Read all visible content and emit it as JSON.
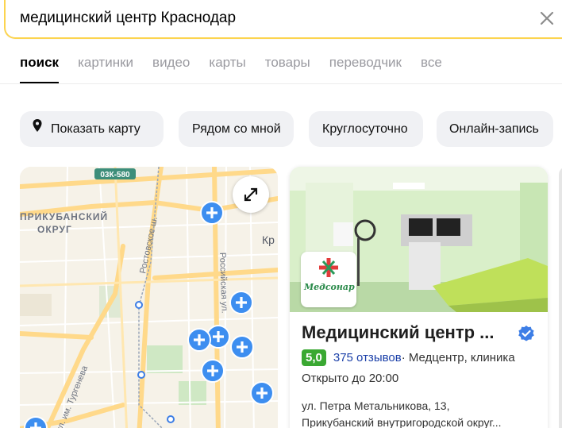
{
  "search": {
    "query": "медицинский центр Краснодар"
  },
  "tabs": [
    {
      "label": "поиск",
      "active": true
    },
    {
      "label": "картинки"
    },
    {
      "label": "видео"
    },
    {
      "label": "карты"
    },
    {
      "label": "товары"
    },
    {
      "label": "переводчик"
    },
    {
      "label": "все"
    }
  ],
  "chips": [
    {
      "label": "Показать карту",
      "icon": "map-pin-icon"
    },
    {
      "label": "Рядом со мной"
    },
    {
      "label": "Круглосуточно"
    },
    {
      "label": "Онлайн-запись"
    }
  ],
  "map": {
    "road_badge": "03К-580",
    "district_label_line1": "ПРИКУБАНСКИЙ",
    "district_label_line2": "ОКРУГ",
    "street_rostovskoe": "Ростовское ш.",
    "street_rossiyskaya": "Российская ул.",
    "street_turgeneva": "ул. им. Тургенева",
    "city_label": "Кр",
    "icon": "medical-cross-marker-icon",
    "colors": {
      "background": "#f6f2e8",
      "road": "#ffd98a",
      "park": "#cfe8c4",
      "marker": "#3d8ef0"
    }
  },
  "org": {
    "title": "Медицинский центр ...",
    "rating": "5,0",
    "reviews": "375 отзывов",
    "category": " · Медцентр, клиника",
    "hours": "Открыто до 20:00",
    "address_line1": "ул. Петра Метальникова, 13,",
    "address_line2": "Прикубанский внутригородской округ...",
    "logo_text": "Медсонар",
    "verified_icon": "verified-check-icon",
    "colors": {
      "rating_badge": "#3aa832",
      "reviews_link": "#1a3fa8",
      "verified": "#3d7ee6"
    }
  },
  "colors": {
    "search_border": "#fcd44f",
    "chip_bg": "#f0f1f4",
    "tab_inactive": "#9a9aa0"
  }
}
